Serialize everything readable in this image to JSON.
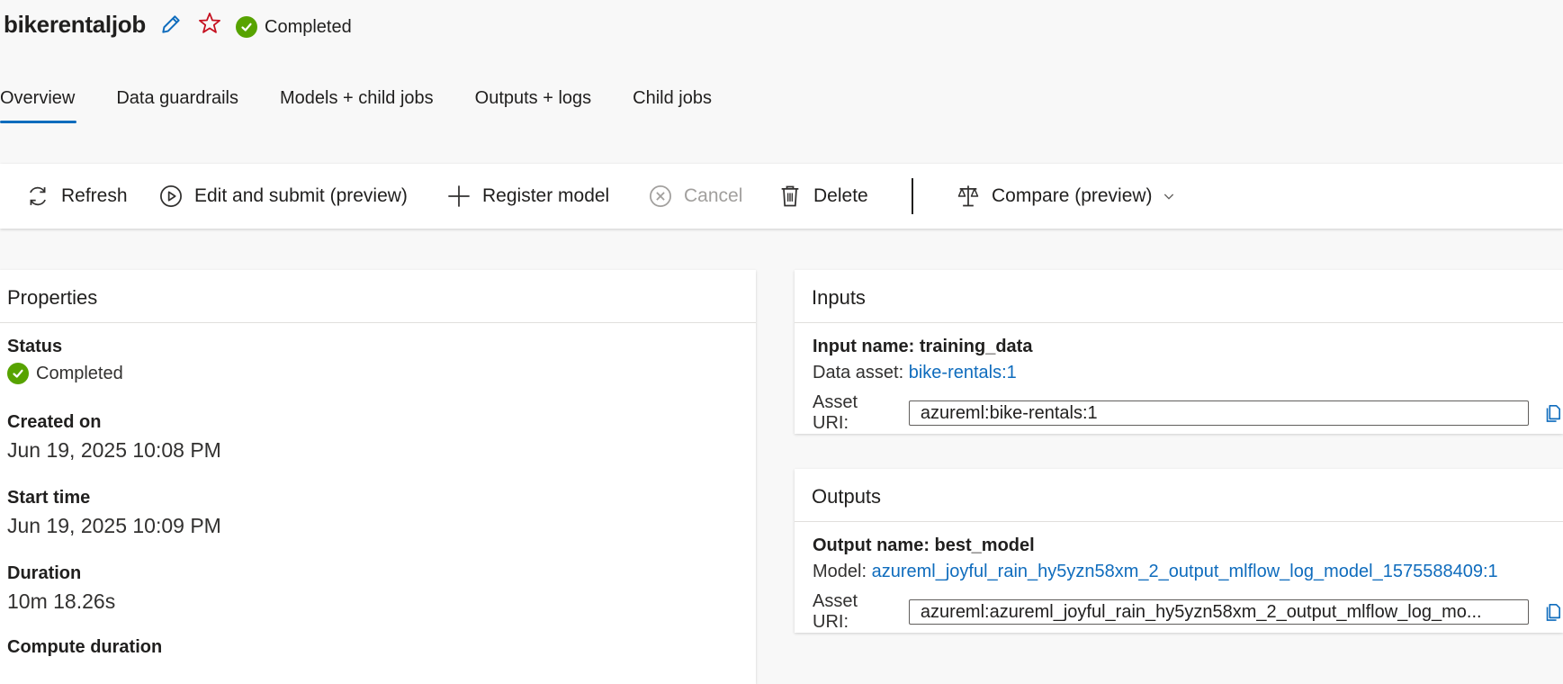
{
  "header": {
    "job_name": "bikerentaljob",
    "status": "Completed"
  },
  "tabs": [
    {
      "label": "Overview",
      "active": true
    },
    {
      "label": "Data guardrails",
      "active": false
    },
    {
      "label": "Models + child jobs",
      "active": false
    },
    {
      "label": "Outputs + logs",
      "active": false
    },
    {
      "label": "Child jobs",
      "active": false
    }
  ],
  "toolbar": {
    "refresh": "Refresh",
    "edit_submit": "Edit and submit (preview)",
    "register_model": "Register model",
    "cancel": "Cancel",
    "delete": "Delete",
    "compare": "Compare (preview)"
  },
  "properties": {
    "title": "Properties",
    "status_label": "Status",
    "status_value": "Completed",
    "created_label": "Created on",
    "created_value": "Jun 19, 2025 10:08 PM",
    "start_label": "Start time",
    "start_value": "Jun 19, 2025 10:09 PM",
    "duration_label": "Duration",
    "duration_value": "10m 18.26s",
    "compute_duration_label": "Compute duration"
  },
  "inputs": {
    "title": "Inputs",
    "name_line": "Input name: training_data",
    "asset_prefix": "Data asset: ",
    "asset_link": "bike-rentals:1",
    "uri_label": "Asset URI:",
    "uri_value": "azureml:bike-rentals:1"
  },
  "outputs": {
    "title": "Outputs",
    "name_line": "Output name: best_model",
    "asset_prefix": "Model: ",
    "asset_link": "azureml_joyful_rain_hy5yzn58xm_2_output_mlflow_log_model_1575588409:1",
    "uri_label": "Asset URI:",
    "uri_value": "azureml:azureml_joyful_rain_hy5yzn58xm_2_output_mlflow_log_mo..."
  },
  "colors": {
    "accent": "#0f6cbd",
    "success": "#57a300",
    "star": "#c50f1f"
  }
}
